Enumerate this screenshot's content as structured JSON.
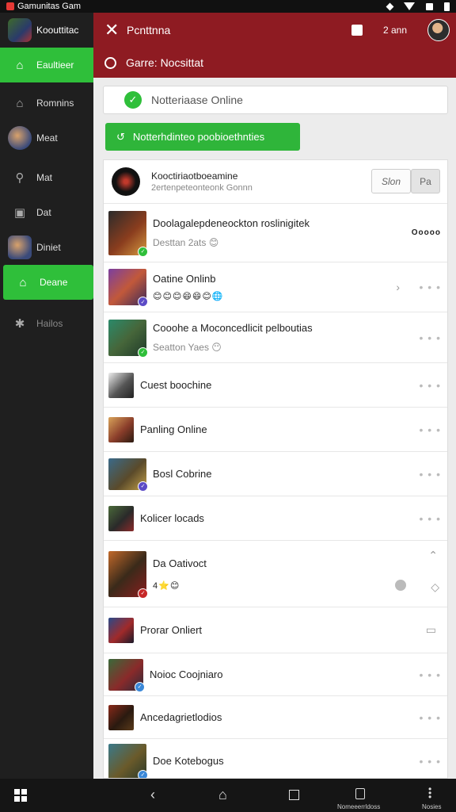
{
  "status_bar": {
    "app_name": "Gamunitas Gam"
  },
  "sidebar": {
    "header_label": "Koouttitac",
    "items": [
      {
        "label": "Eaultieer",
        "icon": "home-icon",
        "active": true
      },
      {
        "label": "Romnins",
        "icon": "home-icon",
        "active": false
      },
      {
        "label": "Meat",
        "icon": "avatar",
        "active": false
      },
      {
        "label": "Mat",
        "icon": "search-icon",
        "active": false
      },
      {
        "label": "Dat",
        "icon": "image-icon",
        "active": false
      },
      {
        "label": "Diniet",
        "icon": "avatar",
        "active": false
      },
      {
        "label": "Deane",
        "icon": "home-icon",
        "active": true
      },
      {
        "label": "Hailos",
        "icon": "settings-icon",
        "active": false,
        "dim": true
      }
    ]
  },
  "header": {
    "title": "Pcnttnna",
    "count": "2 ann",
    "subtitle": "Garre:  Nocsittat"
  },
  "status_card": {
    "text": "Notteriaase Online"
  },
  "green_button": {
    "label": "Notterhdinteo poobioethnties"
  },
  "list_header": {
    "title": "Kooctiriaotboeamine",
    "subtitle": "2ertenpeteonteonk Gonnn",
    "pill1": "Slon",
    "pill2": "Pa"
  },
  "rows": [
    {
      "name": "Doolagalepdeneockton roslinigitek",
      "sub": "Desttan  2ats 😊",
      "action": "Ooooo"
    },
    {
      "name": "Oatine Onlinb",
      "emojis": "😊😊😊😄😄😊🌐",
      "action": "• • •"
    },
    {
      "name": "Cooohe a Moconcedlicit pelboutias",
      "sub": "Seatton  Yaes 😶",
      "action": "• • •"
    },
    {
      "name": "Cuest boochine",
      "action": "• • •"
    },
    {
      "name": "Panling Online",
      "action": "• • •"
    },
    {
      "name": "Bosl Cobrine",
      "action": "• • •"
    },
    {
      "name": "Kolicer locads",
      "action": "• • •"
    },
    {
      "name": "Da Oativoct",
      "emojis": "4⭐😊",
      "action": ""
    },
    {
      "name": "Prorar Onliert",
      "action": ""
    },
    {
      "name": "Noioc Coojniaro",
      "action": "• • •"
    },
    {
      "name": "Ancedagrietlodios",
      "action": "• • •"
    },
    {
      "name": "Doe Kotebogus",
      "action": "• • •"
    }
  ],
  "bottom_bar": {
    "label_a": "Nomeeerrldoss",
    "label_b": "Nosies"
  },
  "colors": {
    "header_bg": "#8e1b22",
    "accent_green": "#2fbf3a",
    "sidebar_bg": "#1f1f1f"
  }
}
